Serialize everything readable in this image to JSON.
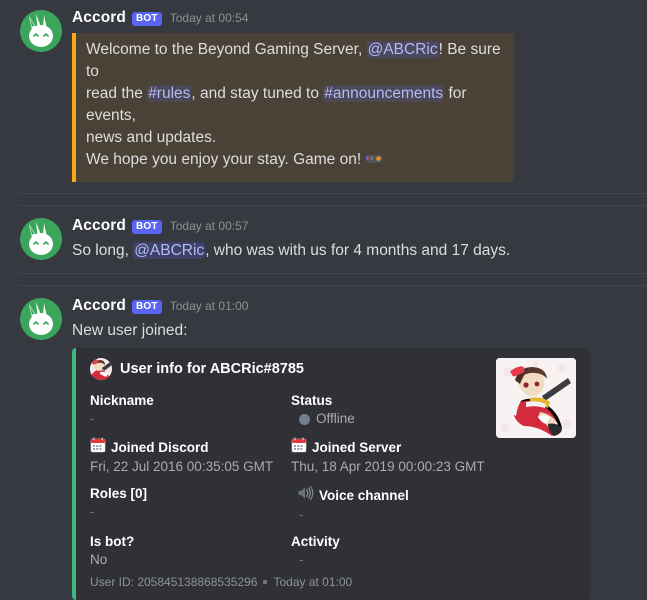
{
  "theme": {
    "bg": "#36393f",
    "embed_bg": "#2f3136",
    "embed_accent": "#43b581",
    "quote_accent": "#faa81a",
    "quote_bg": "#4a4236",
    "bot_badge_bg": "#5865f2",
    "mention_color": "#b3baf7",
    "offline_dot": "#747f8d",
    "divider": "#42464d"
  },
  "messages": [
    {
      "author": "Accord",
      "bot_label": "BOT",
      "timestamp": "Today at 00:54",
      "avatar_icon": "bunny-avatar",
      "quote": {
        "line1_pre": "Welcome to the Beyond Gaming Server, ",
        "mention_user": "@ABCRic",
        "line1_post": "! Be sure to",
        "line2_pre": "read the ",
        "chan_rules": "#rules",
        "line2_mid": ", and stay tuned to ",
        "chan_announcements": "#announcements",
        "line2_post": " for events,",
        "line3": "news and updates.",
        "line4": "We hope you enjoy your stay. Game on!",
        "emoji": "video-game-controller"
      }
    },
    {
      "author": "Accord",
      "bot_label": "BOT",
      "timestamp": "Today at 00:57",
      "avatar_icon": "bunny-avatar",
      "text_pre": "So long, ",
      "mention_user": "@ABCRic",
      "text_post": ", who was with us for 4 months and 17 days."
    },
    {
      "author": "Accord",
      "bot_label": "BOT",
      "timestamp": "Today at 01:00",
      "avatar_icon": "bunny-avatar",
      "text": "New user joined:"
    }
  ],
  "embed": {
    "accent_color": "#43b581",
    "author_name": "User info for ABCRic#8785",
    "author_icon": "anime-miko-avatar",
    "thumbnail_icon": "anime-miko-thumbnail",
    "fields": [
      {
        "name": "Nickname",
        "value": "-",
        "icon": ""
      },
      {
        "name": "Status",
        "value": "Offline",
        "icon": "offline-dot"
      },
      {
        "name": "Joined Discord",
        "value": "Fri, 22 Jul 2016 00:35:05 GMT",
        "icon": "calendar-emoji"
      },
      {
        "name": "Joined Server",
        "value": "Thu, 18 Apr 2019 00:00:23 GMT",
        "icon": "calendar-emoji"
      },
      {
        "name": "Roles [0]",
        "value": "-",
        "icon": ""
      },
      {
        "name": "Voice channel",
        "value": "-",
        "icon": "speaker-emoji"
      },
      {
        "name": "Is bot?",
        "value": "No",
        "icon": ""
      },
      {
        "name": "Activity",
        "value": "-",
        "icon": ""
      }
    ],
    "footer_text": "User ID: 205845138868535296",
    "footer_timestamp": "Today at 01:00"
  }
}
